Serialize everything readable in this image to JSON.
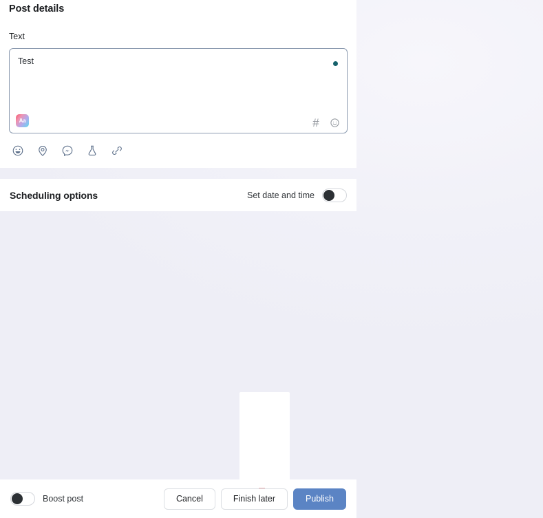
{
  "post_details": {
    "title": "Post details",
    "text_label": "Text",
    "text_value": "Test",
    "status_dot_color": "#16616b",
    "format_badge_label": "Aa",
    "field_tools": [
      {
        "name": "hashtag-icon",
        "glyph": "#"
      },
      {
        "name": "emoji-icon",
        "glyph": "☺"
      }
    ],
    "attachments": [
      {
        "name": "emoji-sticker-icon",
        "label": "Emoji"
      },
      {
        "name": "location-pin-icon",
        "label": "Location"
      },
      {
        "name": "messenger-icon",
        "label": "Messenger"
      },
      {
        "name": "flask-icon",
        "label": "Experiment"
      },
      {
        "name": "link-icon",
        "label": "Link"
      }
    ]
  },
  "scheduling": {
    "title": "Scheduling options",
    "set_date_label": "Set date and time",
    "set_date_toggle_state": "off"
  },
  "action_bar": {
    "boost_label": "Boost post",
    "boost_toggle_state": "off",
    "cancel_label": "Cancel",
    "finish_later_label": "Finish later",
    "publish_label": "Publish",
    "publish_color": "#5b84c4"
  }
}
